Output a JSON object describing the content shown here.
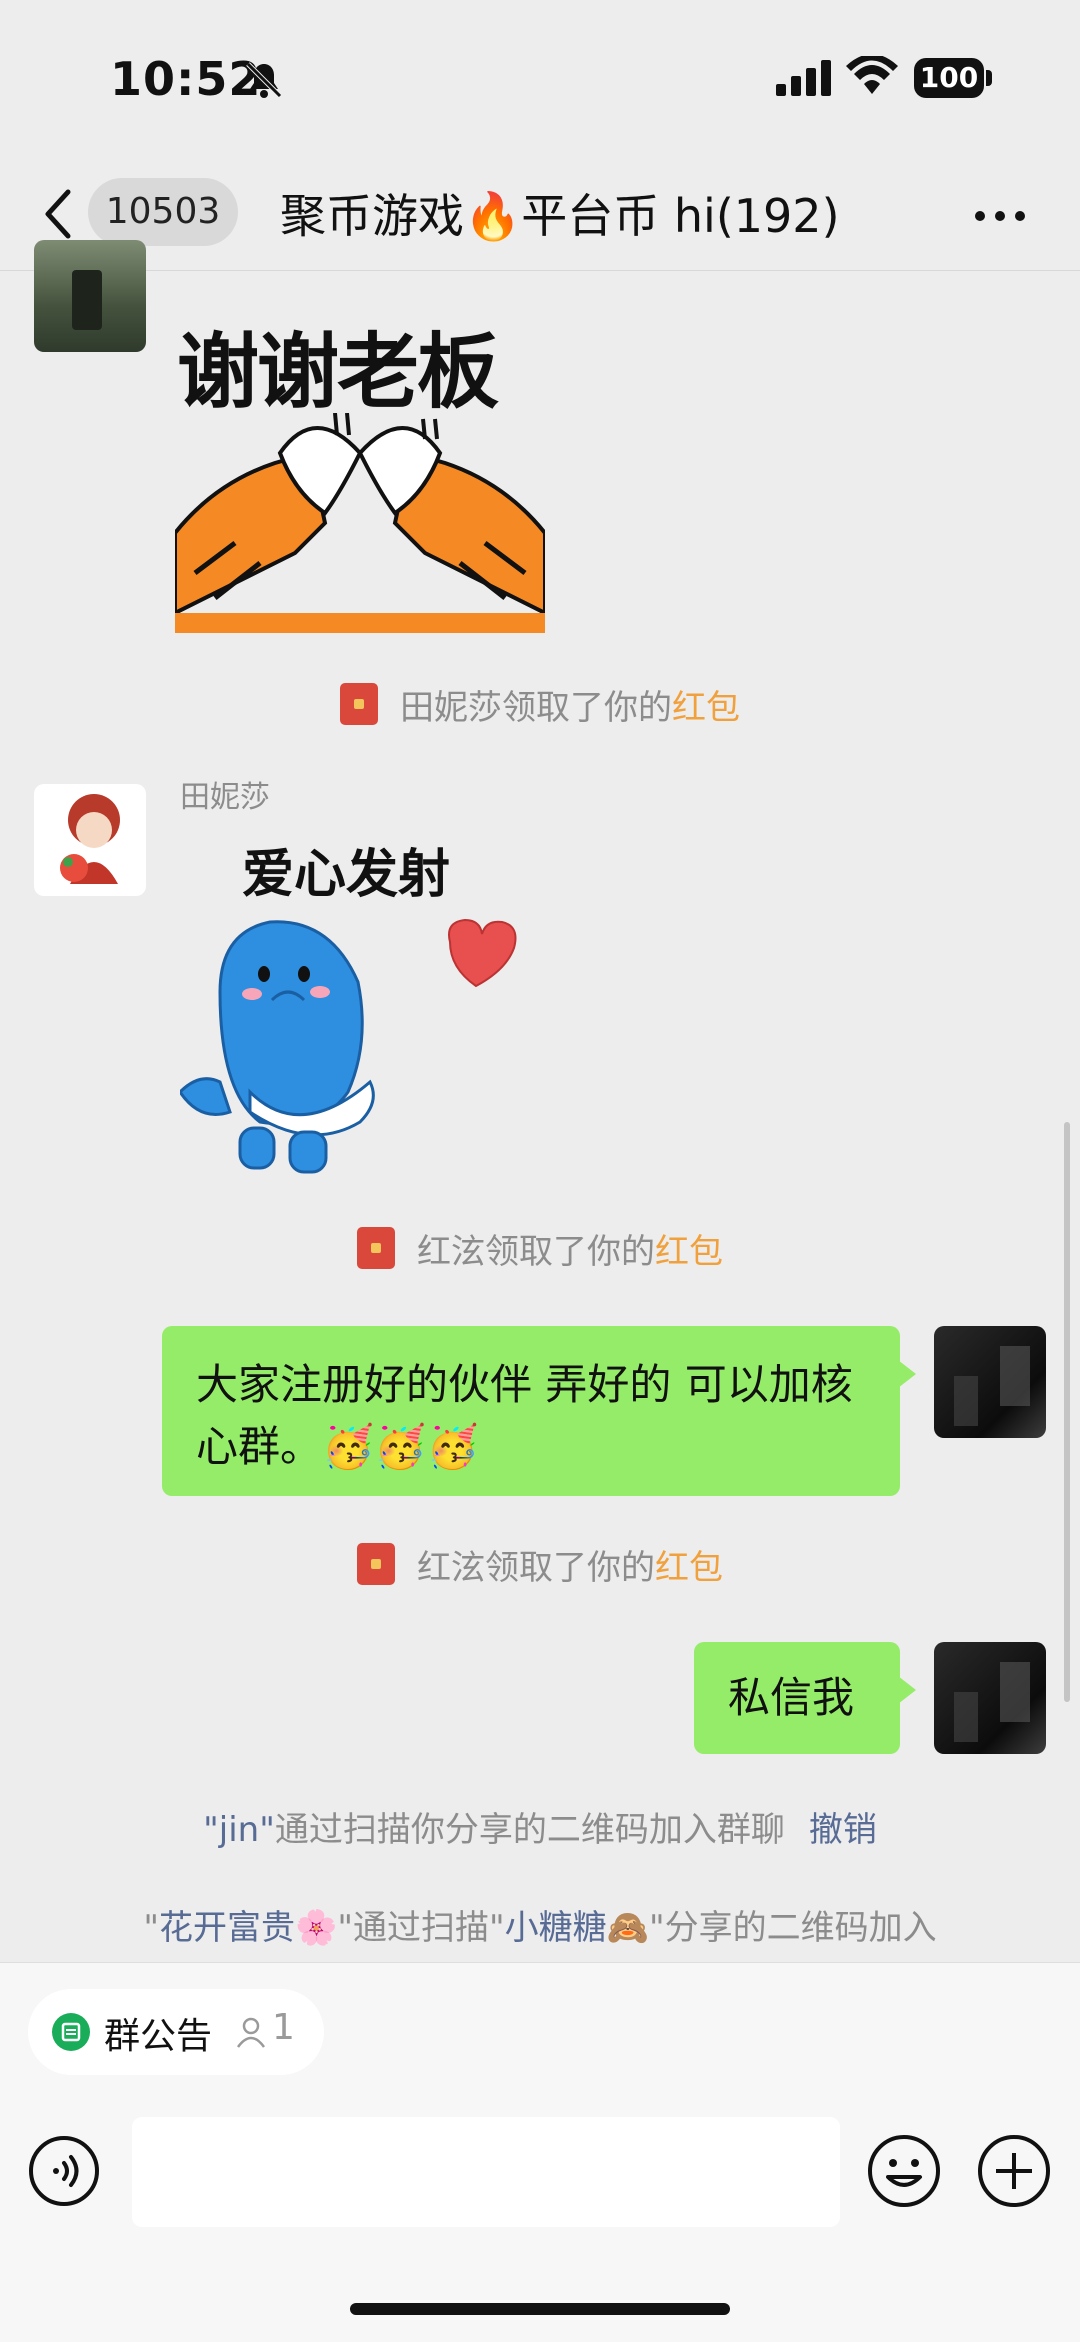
{
  "status_bar": {
    "time": "10:52",
    "battery": "100"
  },
  "nav": {
    "unread_count": "10503",
    "title": "聚币游戏🔥平台币 hi(192)"
  },
  "messages": {
    "sticker1_text": "谢谢老板",
    "sys1": {
      "who": "田妮莎领取了你的",
      "what": "红包"
    },
    "sender2": "田妮莎",
    "sticker2_text": "爱心发射",
    "sys2": {
      "who": "红泫领取了你的",
      "what": "红包"
    },
    "bubble1": "大家注册好的伙伴 弄好的 可以加核心群。🥳🥳🥳",
    "sys3": {
      "who": "红泫领取了你的",
      "what": "红包"
    },
    "bubble2": "私信我",
    "join1": {
      "name": "\"jin\"",
      "text": "通过扫描你分享的二维码加入群聊",
      "action": "撤销"
    },
    "join2": {
      "q1": "\"",
      "name": "花开富贵🌸",
      "mid": "\"通过扫描\"",
      "name2": "小糖糖🙈",
      "tail": "\"分享的二维码加入"
    }
  },
  "bottom": {
    "notice_label": "群公告",
    "notice_count": "1"
  },
  "icons": [
    "back-icon",
    "more-icon",
    "bell-mute-icon",
    "signal-icon",
    "wifi-icon",
    "voice-icon",
    "emoji-icon",
    "plus-icon",
    "notice-icon",
    "person-icon",
    "red-packet-icon"
  ],
  "colors": {
    "bubble": "#95ec69",
    "link": "#576b95",
    "highlight": "#f0a13d"
  }
}
